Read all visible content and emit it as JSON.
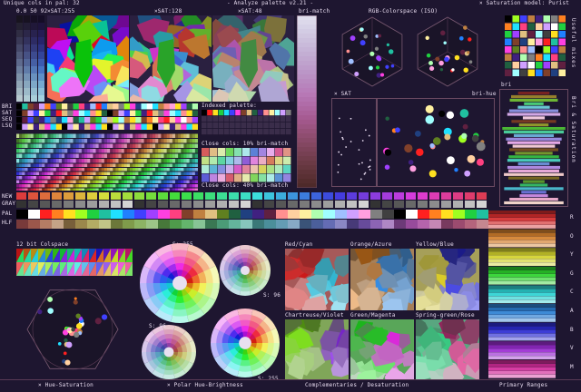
{
  "header": {
    "left": "Unique cols in pal: 32",
    "title": "- Analyze palette v2.21 -",
    "right": "× Saturation model: Purist"
  },
  "top_labels": {
    "bri_cols": "0.0 50 92",
    "xsat255": "×SAT:255",
    "xsat128": "×SAT:128",
    "xsat48": "×SAT:48",
    "brimatch": "bri-match",
    "rgb_colorspace": "RGB-Colorspace (ISO)"
  },
  "mid_labels": {
    "xsat": "× SAT",
    "brihue": "bri-hue",
    "bri": "bri",
    "indexed_palette": "Indexed palette:",
    "close10": "Close cols: 10% bri-match",
    "close40": "Close cols: 40% bri-match"
  },
  "row_labels": [
    "BRI",
    "SAT",
    "SEQ",
    "LSQ"
  ],
  "strip_labels": [
    "NEW",
    "GRAY",
    "PAL",
    "HLF"
  ],
  "bottom_labels": {
    "colspace12": "12 bit Colspace",
    "s255a": "S: 255",
    "s96a": "S: 96",
    "s96b": "S: 96",
    "s255b": "S: 255",
    "red_cyan": "Red/Cyan",
    "orange_azure": "Orange/Azure",
    "yellow_blue": "Yellow/Blue",
    "chartreuse_violet": "Chartreuse/Violet",
    "green_magenta": "Green/Magenta",
    "spring_rose": "Spring-green/Rose"
  },
  "footer": {
    "hue_sat": "× Hue-Saturation",
    "polar": "× Polar Hue-Brightness",
    "complementaries": "Complementaries / Desaturation",
    "primary_ranges": "Primary Ranges"
  },
  "side_right_top": "Useful mixes",
  "side_right_mid": "Bri & Saturation",
  "side_right_letters": [
    "R",
    "O",
    "Y",
    "G",
    "C",
    "A",
    "B",
    "V",
    "M"
  ],
  "palette": [
    "#000000",
    "#ffffff",
    "#ff2020",
    "#ff8020",
    "#ffe020",
    "#a0ff20",
    "#20d040",
    "#20c0a0",
    "#20e0ff",
    "#2080ff",
    "#4040ff",
    "#a040ff",
    "#ff40e0",
    "#ff4080",
    "#80402a",
    "#c08040",
    "#e0c080",
    "#608020",
    "#206040",
    "#204080",
    "#402080",
    "#602040",
    "#ff9090",
    "#ffd0a0",
    "#fff0a0",
    "#b0ffb0",
    "#a0ffff",
    "#a0c0ff",
    "#d0a0ff",
    "#ffa0e0",
    "#808080",
    "#404040"
  ],
  "colors": {
    "bg": "#1e1630",
    "frame": "#6b4a62",
    "text": "#e8dcf0"
  }
}
